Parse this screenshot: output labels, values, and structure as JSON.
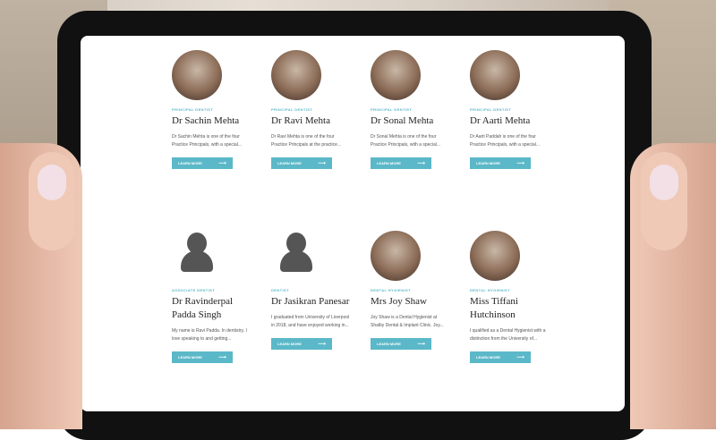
{
  "dentists": [
    {
      "role": "PRINCIPAL DENTIST",
      "name": "Dr Sachin Mehta",
      "desc": "Dr Sachin Mehta is one of the four Practice Principals, with a special...",
      "button": "LEARN MORE",
      "avatar": "photo",
      "arrow": "⟶"
    },
    {
      "role": "PRINCIPAL DENTIST",
      "name": "Dr Ravi Mehta",
      "desc": "Dr Ravi Mehta is one of the four Practice Principals at the practice...",
      "button": "LEARN MORE",
      "avatar": "photo",
      "arrow": "⟶"
    },
    {
      "role": "PRINCIPAL DENTIST",
      "name": "Dr Sonal Mehta",
      "desc": "Dr Sonal Mehta is one of the four Practice Principals, with a special...",
      "button": "LEARN MORE",
      "avatar": "photo",
      "arrow": "⟶"
    },
    {
      "role": "PRINCIPAL DENTIST",
      "name": "Dr Aarti Mehta",
      "desc": "Dr Aarti Paddah is one of the four Practice Principals, with a special...",
      "button": "LEARN MORE",
      "avatar": "photo",
      "arrow": "⟶"
    },
    {
      "role": "ASSOCIATE DENTIST",
      "name": "Dr Ravinderpal Padda Singh",
      "desc": "My name is Ravi Padda. In dentistry, I love speaking to and getting...",
      "button": "LEARN MORE",
      "avatar": "placeholder",
      "arrow": "⟶"
    },
    {
      "role": "DENTIST",
      "name": "Dr Jasikran Panesar",
      "desc": "I graduated from University of Liverpool in 2018, and have enjoyed working in...",
      "button": "LEARN MORE",
      "avatar": "placeholder",
      "arrow": "⟶"
    },
    {
      "role": "DENTAL HYGIENIST",
      "name": "Mrs Joy Shaw",
      "desc": "Joy Shaw is a Dental Hygienist at Shalby Dental & Implant Clinic. Joy...",
      "button": "LEARN MORE",
      "avatar": "photo",
      "arrow": "⟶"
    },
    {
      "role": "DENTAL HYGIENIST",
      "name": "Miss Tiffani Hutchinson",
      "desc": "I qualified as a Dental Hygienist with a distinction from the University of...",
      "button": "LEARN MORE",
      "avatar": "photo",
      "arrow": "⟶"
    }
  ]
}
